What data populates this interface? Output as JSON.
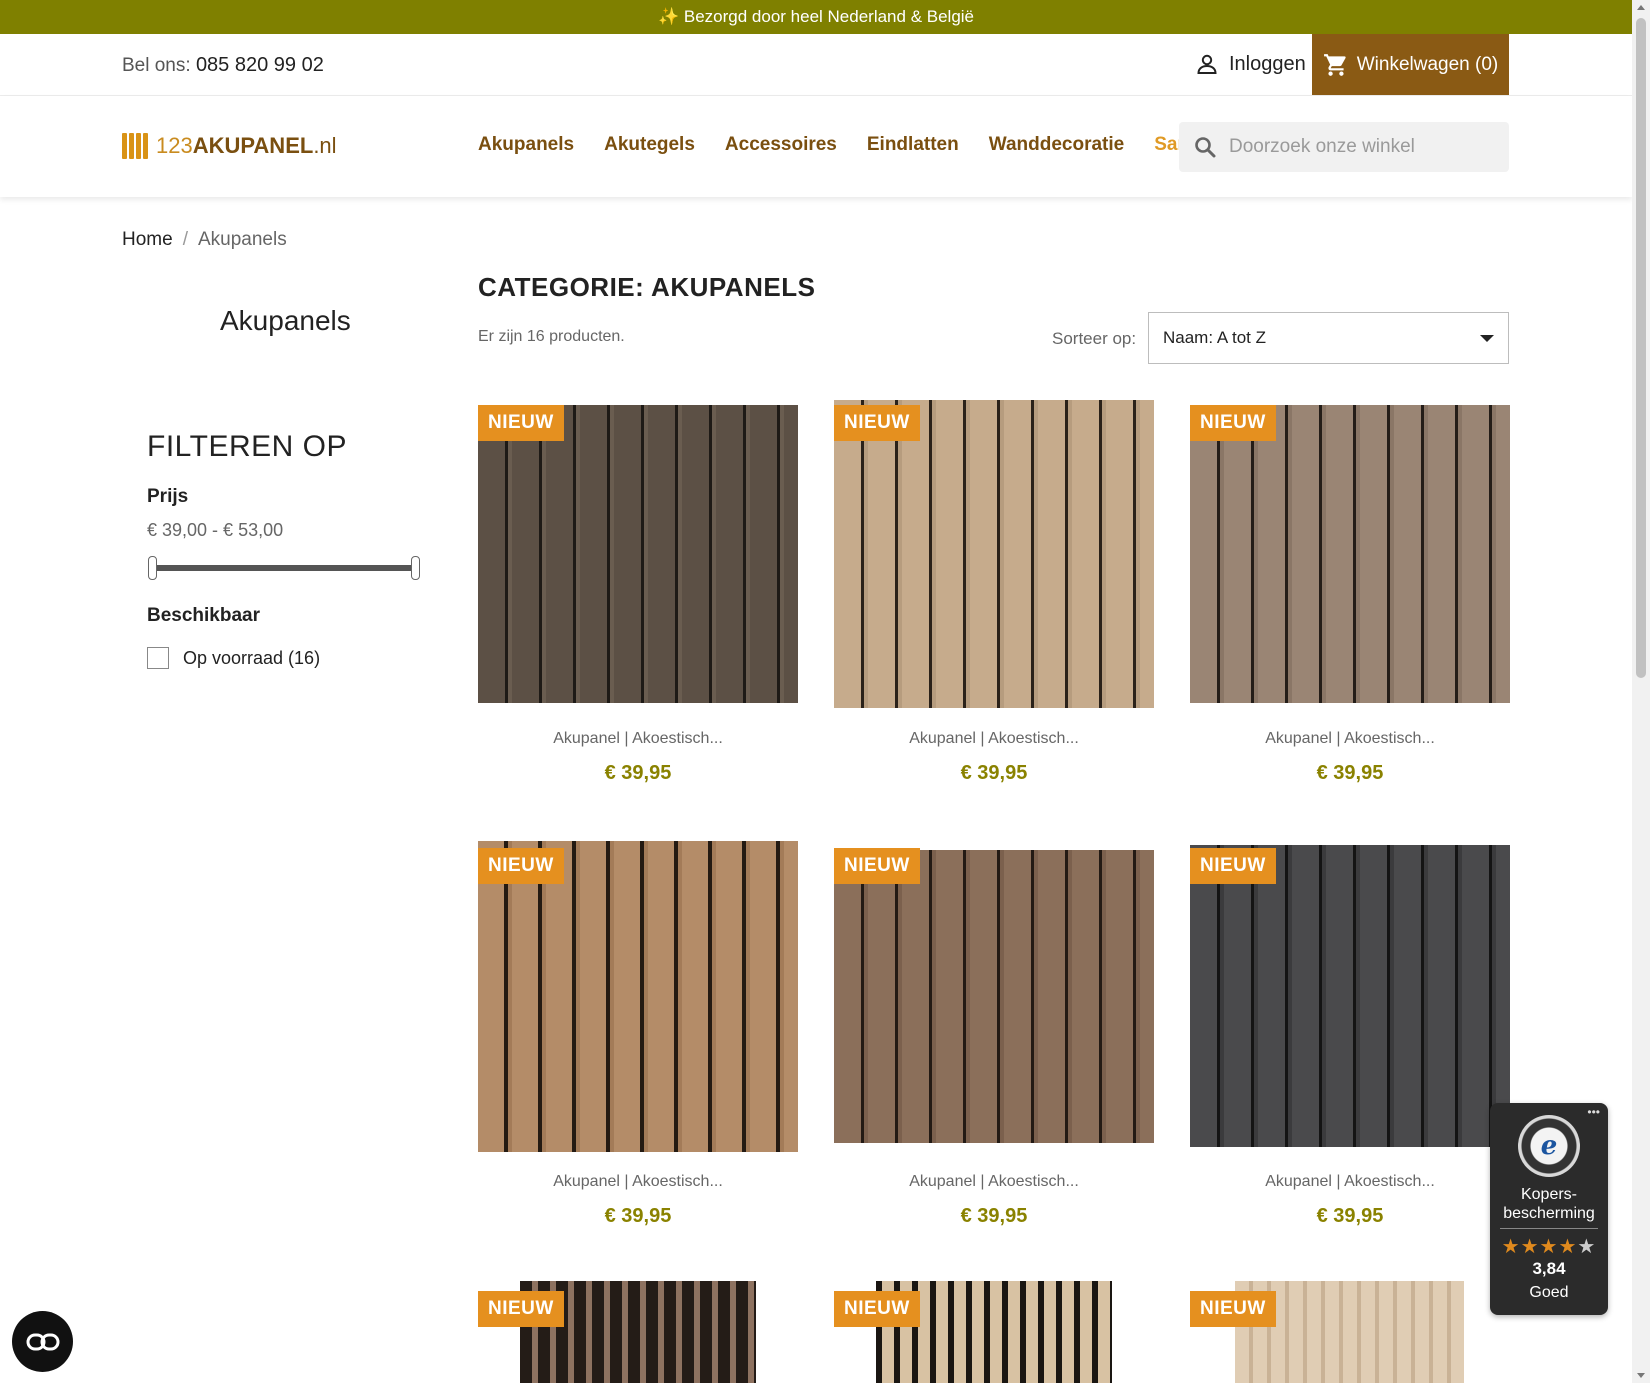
{
  "promo": {
    "text": "✨ Bezorgd door heel Nederland & België"
  },
  "topbar": {
    "phone_label": "Bel ons:",
    "phone_number": "085 820 99 02",
    "login_label": "Inloggen",
    "cart_label": "Winkelwagen (0)"
  },
  "header": {
    "logo": {
      "prefix": "123",
      "brand": "AKUPANEL",
      "suffix": ".nl"
    },
    "nav": [
      "Akupanels",
      "Akutegels",
      "Accessoires",
      "Eindlatten",
      "Wanddecoratie",
      "Sample kit"
    ],
    "search_placeholder": "Doorzoek onze winkel"
  },
  "breadcrumb": {
    "home": "Home",
    "separator": "/",
    "current": "Akupanels"
  },
  "sidebar": {
    "category": "Akupanels",
    "filter_title": "FILTEREN OP",
    "price_label": "Prijs",
    "price_range": "€ 39,00 - € 53,00",
    "price_slider": {
      "min": 39,
      "max": 53,
      "low": 39,
      "high": 53
    },
    "availability_label": "Beschikbaar",
    "in_stock_option": "Op voorraad (16)",
    "in_stock_checked": false
  },
  "main": {
    "title": "CATEGORIE: AKUPANELS",
    "count": "Er zijn 16 producten.",
    "sort_label": "Sorteer op:",
    "sort_value": "Naam: A tot Z"
  },
  "products": [
    {
      "badge": "NIEUW",
      "name": "Akupanel | Akoestisch...",
      "price": "€ 39,95",
      "swatch": "dark"
    },
    {
      "badge": "NIEUW",
      "name": "Akupanel | Akoestisch...",
      "price": "€ 39,95",
      "swatch": "light oak"
    },
    {
      "badge": "NIEUW",
      "name": "Akupanel | Akoestisch...",
      "price": "€ 39,95",
      "swatch": "grey oak"
    },
    {
      "badge": "NIEUW",
      "name": "Akupanel | Akoestisch...",
      "price": "€ 39,95",
      "swatch": "oak"
    },
    {
      "badge": "NIEUW",
      "name": "Akupanel | Akoestisch...",
      "price": "€ 39,95",
      "swatch": "walnut"
    },
    {
      "badge": "NIEUW",
      "name": "Akupanel | Akoestisch...",
      "price": "€ 39,95",
      "swatch": "black"
    },
    {
      "badge": "NIEUW",
      "swatch": "dark slats"
    },
    {
      "badge": "NIEUW",
      "swatch": "light slats"
    },
    {
      "badge": "NIEUW",
      "swatch": "white oak"
    }
  ],
  "trust_widget": {
    "title": "Kopers-\nbescherming",
    "stars_filled": 4,
    "stars_total": 5,
    "score": "3,84",
    "grade": "Goed"
  },
  "icons": {
    "user": "user-icon",
    "cart": "cart-icon",
    "search": "search-icon",
    "accessibility": "accessibility-icon"
  },
  "colors": {
    "promo_bg": "#7f8000",
    "cart_bg": "#8a5a14",
    "nav_text": "#7a4f10",
    "nav_highlight": "#e09a25",
    "badge_bg": "#e5901f",
    "price_text": "#8a8200"
  }
}
